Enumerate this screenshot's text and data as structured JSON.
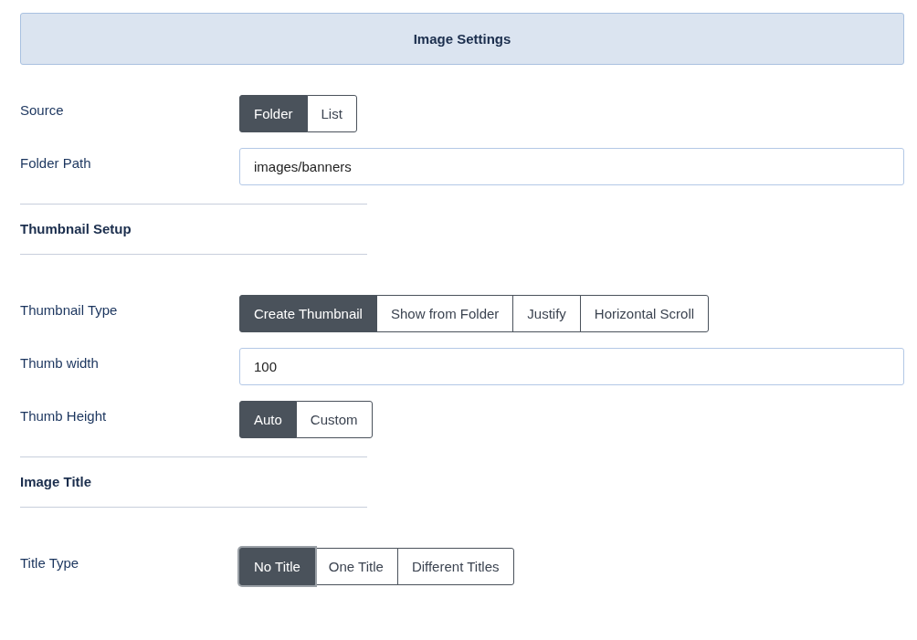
{
  "header": {
    "title": "Image Settings"
  },
  "fields": [
    {
      "kind": "segmented",
      "label": "Source",
      "options": [
        {
          "label": "Folder",
          "selected": true,
          "focused": false
        },
        {
          "label": "List",
          "selected": false,
          "focused": false
        }
      ]
    },
    {
      "kind": "text",
      "label": "Folder Path",
      "value": "images/banners"
    },
    {
      "kind": "section",
      "label": "Thumbnail Setup"
    },
    {
      "kind": "segmented",
      "label": "Thumbnail Type",
      "options": [
        {
          "label": "Create Thumbnail",
          "selected": true,
          "focused": false
        },
        {
          "label": "Show from Folder",
          "selected": false,
          "focused": false
        },
        {
          "label": "Justify",
          "selected": false,
          "focused": false
        },
        {
          "label": "Horizontal Scroll",
          "selected": false,
          "focused": false
        }
      ]
    },
    {
      "kind": "text",
      "label": "Thumb width",
      "value": "100"
    },
    {
      "kind": "segmented",
      "label": "Thumb Height",
      "options": [
        {
          "label": "Auto",
          "selected": true,
          "focused": false
        },
        {
          "label": "Custom",
          "selected": false,
          "focused": false
        }
      ]
    },
    {
      "kind": "section",
      "label": "Image Title"
    },
    {
      "kind": "segmented",
      "label": "Title Type",
      "options": [
        {
          "label": "No Title",
          "selected": true,
          "focused": true
        },
        {
          "label": "One Title",
          "selected": false,
          "focused": false
        },
        {
          "label": "Different Titles",
          "selected": false,
          "focused": false
        }
      ]
    }
  ]
}
